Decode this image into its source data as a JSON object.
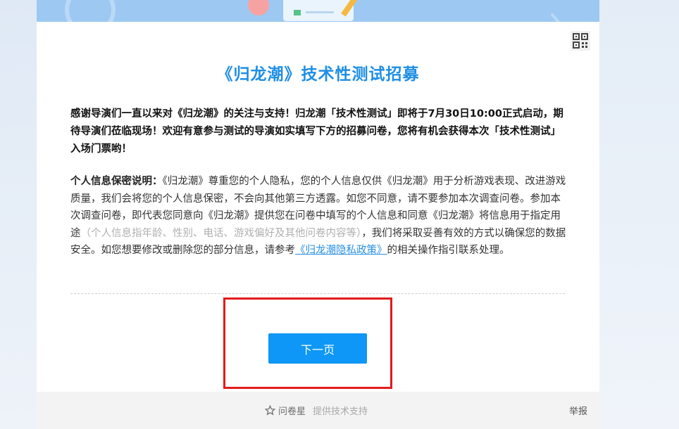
{
  "survey": {
    "title": "《归龙潮》技术性测试招募",
    "intro": "感谢导演们一直以来对《归龙潮》的关注与支持！归龙潮「技术性测试」即将于7月30日10:00正式启动，期待导演们莅临现场！欢迎有意参与测试的导演如实填写下方的招募问卷，您将有机会获得本次「技术性测试」入场门票哟！",
    "privacy": {
      "lead": "个人信息保密说明：",
      "text1": "《归龙潮》尊重您的个人隐私，您的个人信息仅供《归龙潮》用于分析游戏表现、改进游戏质量，我们会将您的个人信息保密，不会向其他第三方透露。如您不同意，请不要参加本次调查问卷。参加本次调查问卷，即代表您同意向《归龙潮》提供您在问卷中填写的个人信息和同意《归龙潮》将信息用于指定用途",
      "muted": "（个人信息指年龄、性别、电话、游戏偏好及其他问卷内容等）",
      "text2": "，我们将采取妥善有效的方式以确保您的数据安全。如您想要修改或删除您的部分信息，请参考",
      "link": "《归龙潮隐私政策》",
      "text3": "的相关操作指引联系处理。"
    },
    "next_label": "下一页"
  },
  "footer": {
    "brand": "问卷星",
    "support": "提供技术支持",
    "report": "举报"
  },
  "icons": {
    "qr": "qr-code-icon",
    "star": "star-outline-icon"
  },
  "colors": {
    "title": "#1e8ee6",
    "button": "#0e97f6",
    "highlight": "#e31b1b",
    "link": "#2a8fe3"
  }
}
